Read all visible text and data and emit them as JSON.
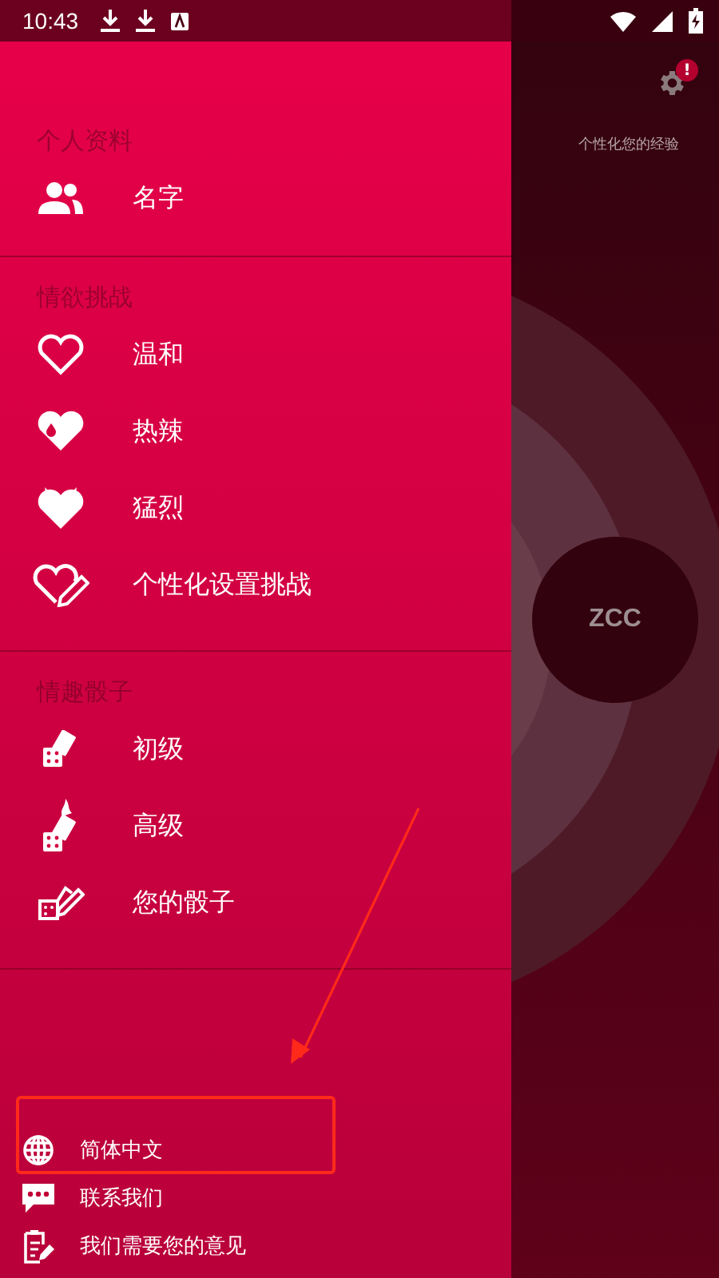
{
  "status_bar": {
    "time": "10:43"
  },
  "background": {
    "settings_badge": "!",
    "caption": "个性化您的经验",
    "circle_label": "ZCC"
  },
  "drawer": {
    "sections": [
      {
        "title": "个人资料",
        "items": [
          {
            "label": "名字",
            "kind": "users"
          }
        ]
      },
      {
        "title": "情欲挑战",
        "items": [
          {
            "label": "温和",
            "kind": "heart-outline"
          },
          {
            "label": "热辣",
            "kind": "heart-drop"
          },
          {
            "label": "猛烈",
            "kind": "heart-horns"
          },
          {
            "label": "个性化设置挑战",
            "kind": "heart-pencil"
          }
        ]
      },
      {
        "title": "情趣骰子",
        "items": [
          {
            "label": "初级",
            "kind": "dice"
          },
          {
            "label": "高级",
            "kind": "dice-flame"
          },
          {
            "label": "您的骰子",
            "kind": "dice-pencil"
          }
        ]
      }
    ],
    "footer": [
      {
        "label": "简体中文",
        "kind": "globe",
        "highlighted": true
      },
      {
        "label": "联系我们",
        "kind": "chat",
        "highlighted": false
      },
      {
        "label": "我们需要您的意见",
        "kind": "clipboard",
        "highlighted": false
      }
    ]
  }
}
